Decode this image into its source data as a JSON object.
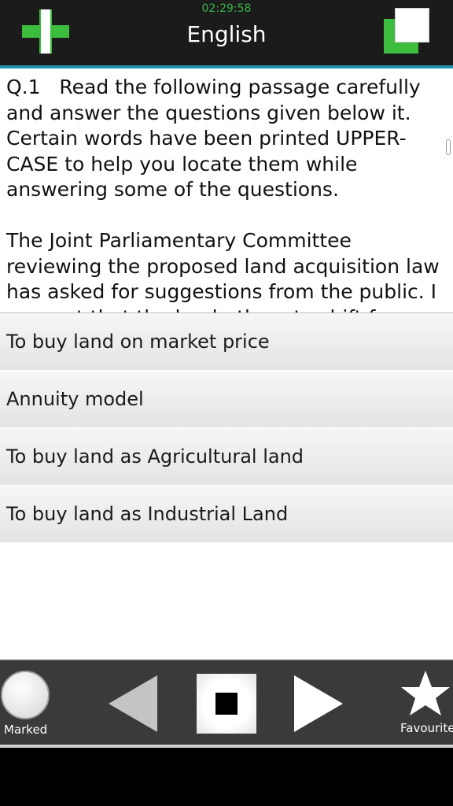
{
  "header": {
    "clock": "02:29:58",
    "title": "English",
    "left_icon": "plus-icon",
    "right_icon": "copy-icon"
  },
  "question": {
    "text": "Q.1   Read the following passage carefully and answer the questions given below it. Certain words have been printed UPPER-CASE to help you locate them while answering some of the questions.\n\nThe Joint Parliamentary Committee reviewing the proposed land acquisition law has asked for suggestions from the public. I suggest that the land-others to shift from a mechanism"
  },
  "options": [
    {
      "label": "To buy land on market price"
    },
    {
      "label": "Annuity model"
    },
    {
      "label": "To buy land as Agricultural land"
    },
    {
      "label": "To buy land as Industrial Land"
    }
  ],
  "bottom_bar": {
    "marked_label": "Marked",
    "favourite_label": "Favourite",
    "icons": [
      "circle-icon",
      "previous-icon",
      "stop-icon",
      "next-icon",
      "star-icon"
    ]
  },
  "colors": {
    "header_bg": "#1b1b1b",
    "accent_blue": "#1f8fb3",
    "accent_green": "#3dbd3d",
    "clock_green": "#39b54a",
    "bottom_bar_bg": "#3a3a3a"
  }
}
